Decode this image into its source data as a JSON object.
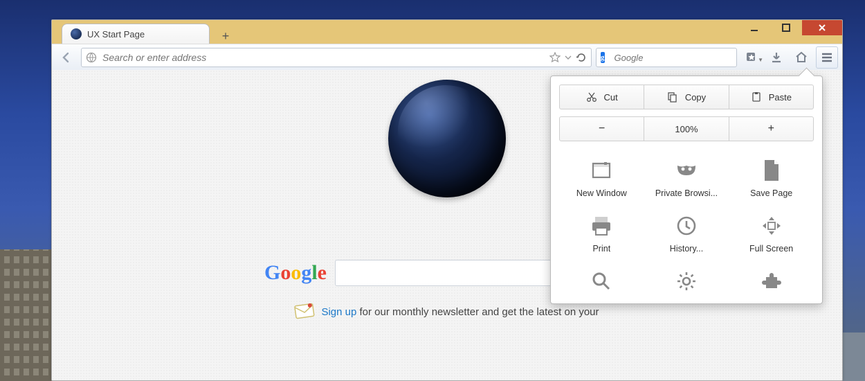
{
  "tab": {
    "title": "UX Start Page"
  },
  "urlbar": {
    "placeholder": "Search or enter address"
  },
  "searchbar": {
    "placeholder": "Google",
    "engine_letter": "g"
  },
  "menu": {
    "edit": {
      "cut": "Cut",
      "copy": "Copy",
      "paste": "Paste"
    },
    "zoom_level": "100%",
    "items": [
      {
        "label": "New Window"
      },
      {
        "label": "Private Browsi..."
      },
      {
        "label": "Save Page"
      },
      {
        "label": "Print"
      },
      {
        "label": "History..."
      },
      {
        "label": "Full Screen"
      }
    ]
  },
  "content": {
    "signup_link": "Sign up",
    "signup_rest": " for our monthly newsletter and get the latest on your"
  }
}
